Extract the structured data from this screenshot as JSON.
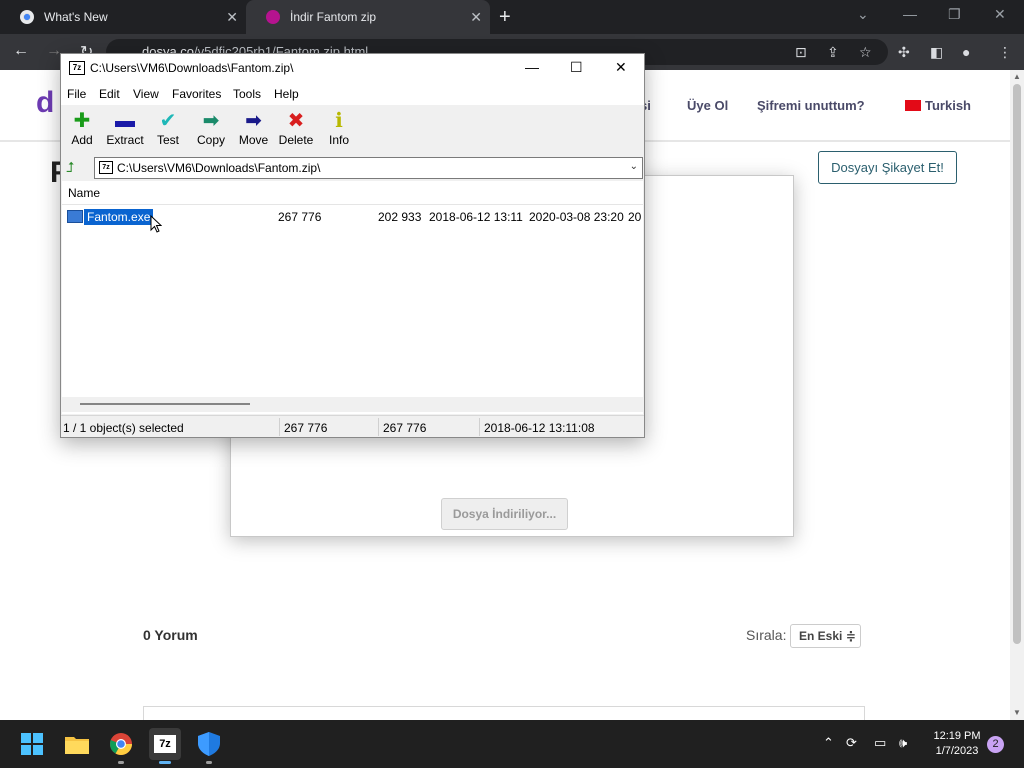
{
  "browser": {
    "tabs": [
      {
        "title": "What's New",
        "close": "✕"
      },
      {
        "title": "İndir Fantom zip",
        "close": "✕"
      }
    ],
    "new_tab": "+",
    "url_domain": "dosya.co",
    "url_path": "/v5dfic205rb1/Fantom.zip.html"
  },
  "site": {
    "logo": "d",
    "nav": [
      "şi",
      "Üye Ol",
      "Şifremi unuttum?",
      "Turkish"
    ],
    "page_title": "F",
    "report_button": "Dosyayı Şikayet Et!",
    "download_button": "Dosya İndiriliyor...",
    "comments_title": "0 Yorum",
    "sort_label": "Sırala:",
    "sort_value": "En Eski ≑"
  },
  "zip": {
    "title": "C:\\Users\\VM6\\Downloads\\Fantom.zip\\",
    "app_icon": "7z",
    "menu": [
      "File",
      "Edit",
      "View",
      "Favorites",
      "Tools",
      "Help"
    ],
    "tools": [
      {
        "label": "Add",
        "icon": "plus-icon",
        "color": "#1a9c1a",
        "glyph": "✚"
      },
      {
        "label": "Extract",
        "icon": "minus-icon",
        "color": "#1a1aa8",
        "glyph": "▬"
      },
      {
        "label": "Test",
        "icon": "check-icon",
        "color": "#1fb8b8",
        "glyph": "✔"
      },
      {
        "label": "Copy",
        "icon": "copy-arrow-icon",
        "color": "#1a8a6a",
        "glyph": "➡"
      },
      {
        "label": "Move",
        "icon": "move-arrow-icon",
        "color": "#1a1a8a",
        "glyph": "➡"
      },
      {
        "label": "Delete",
        "icon": "delete-x-icon",
        "color": "#d81e1e",
        "glyph": "✖"
      },
      {
        "label": "Info",
        "icon": "info-icon",
        "color": "#b8b800",
        "glyph": "ℹ"
      }
    ],
    "address": "C:\\Users\\VM6\\Downloads\\Fantom.zip\\",
    "column_name": "Name",
    "file": {
      "name": "Fantom.exe",
      "size": "267 776",
      "packed": "202 933",
      "modified": "2018-06-12 13:11",
      "created": "2020-03-08 23:20",
      "accessed": "20"
    },
    "status": {
      "selection": "1 / 1 object(s) selected",
      "size": "267 776",
      "total": "267 776",
      "date": "2018-06-12 13:11:08"
    }
  },
  "taskbar": {
    "time": "12:19 PM",
    "date": "1/7/2023",
    "notifications": "2",
    "zip_label": "7z"
  }
}
